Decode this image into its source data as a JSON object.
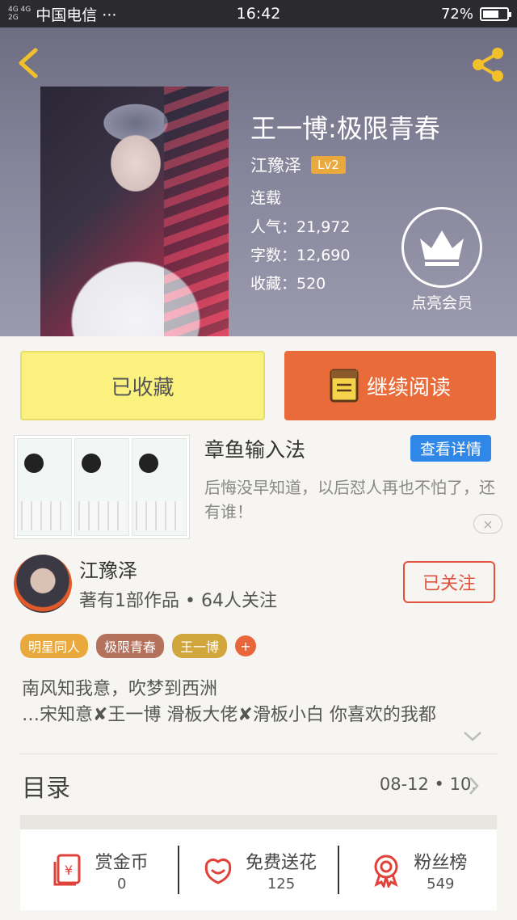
{
  "status_bar": {
    "signal_top": "4G 4G",
    "signal_bottom": "2G",
    "carrier": "中国电信 ···",
    "time": "16:42",
    "battery": "72%",
    "battery_level": 0.72
  },
  "header": {
    "icons": [
      "back-arrow-icon",
      "share-icon"
    ],
    "book_title": "王一博:极限青春",
    "author": "江豫泽",
    "level": "Lv2",
    "status": "连载",
    "popularity": "人气：21,972",
    "word_count": "字数：12,690",
    "collections": "收藏：520",
    "vip_label": "点亮会员"
  },
  "actions": {
    "collected_label": "已收藏",
    "continue_label": "继续阅读"
  },
  "ad": {
    "title": "章鱼输入法",
    "details_label": "查看详情",
    "description": "后悔没早知道，以后怼人再也不怕了，还有谁！",
    "close_icon": "×"
  },
  "author_card": {
    "name": "江豫泽",
    "stats": "著有1部作品 • 64人关注",
    "follow_label": "已关注"
  },
  "tags": [
    {
      "label": "明星同人",
      "color": "#e9a93d"
    },
    {
      "label": "极限青春",
      "color": "#b4715c"
    },
    {
      "label": "王一博",
      "color": "#d0a63d"
    }
  ],
  "tag_add": "+",
  "description": {
    "line1": "南风知我意，吹梦到西洲",
    "line2": "…宋知意✘王一博  滑板大佬✘滑板小白  你喜欢的我都"
  },
  "toc": {
    "title": "目录",
    "date": "08-12  •  10."
  },
  "stats": [
    {
      "label": "赏金币",
      "value": "0",
      "icon": "red-envelope-icon"
    },
    {
      "label": "免费送花",
      "value": "125",
      "icon": "flower-icon"
    },
    {
      "label": "粉丝榜",
      "value": "549",
      "icon": "medal-icon"
    }
  ],
  "colors": {
    "accent_orange": "#ea6b3a",
    "collected_yellow": "#faf17e",
    "follow_red": "#e0523c",
    "details_blue": "#2f88e8"
  }
}
